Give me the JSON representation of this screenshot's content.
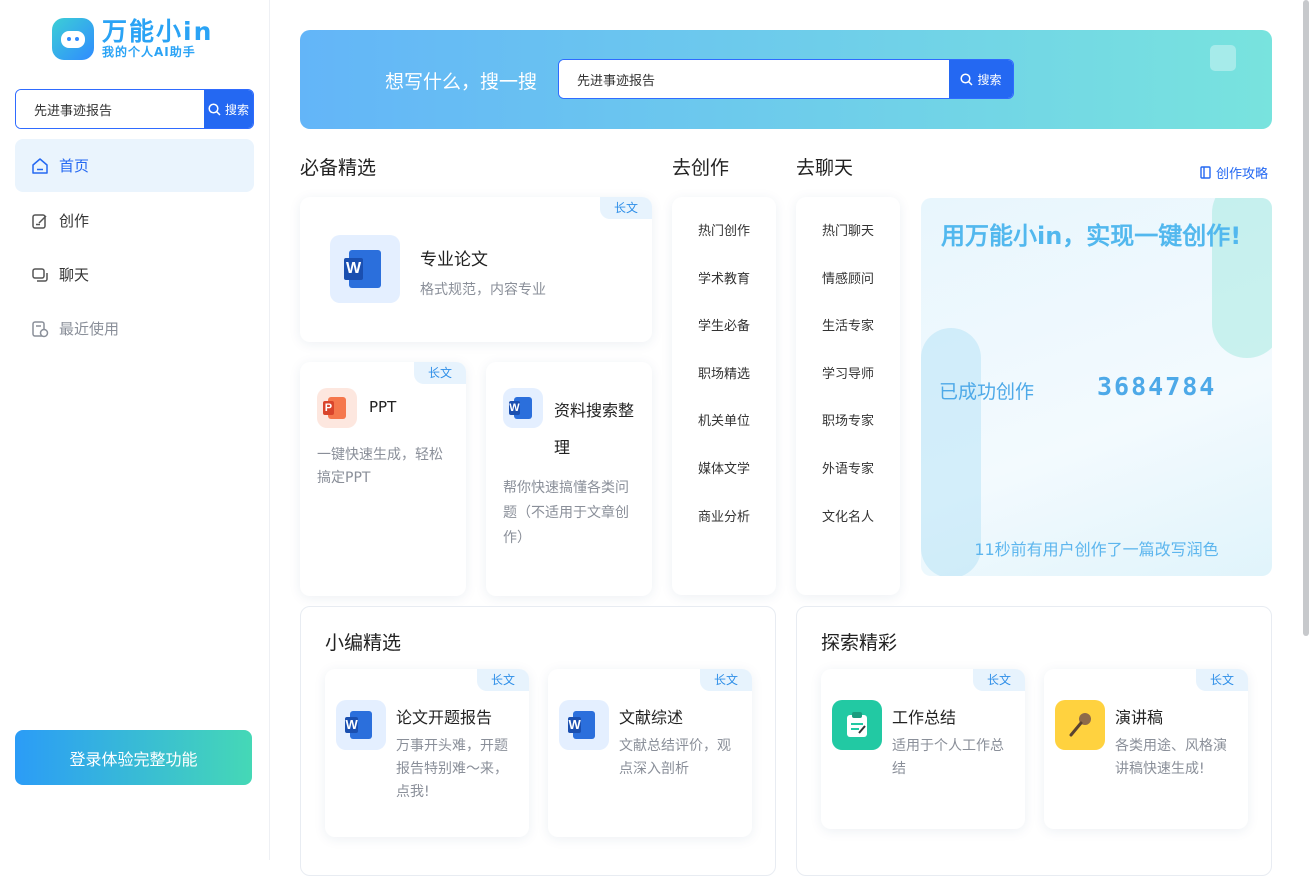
{
  "brand": {
    "title": "万能小in",
    "subtitle": "我的个人AI助手"
  },
  "sidebar": {
    "search_value": "先进事迹报告",
    "search_label": "搜索",
    "items": [
      {
        "label": "首页"
      },
      {
        "label": "创作"
      },
      {
        "label": "聊天"
      },
      {
        "label": "最近使用"
      }
    ],
    "login_label": "登录体验完整功能"
  },
  "banner": {
    "prompt": "想写什么，搜一搜",
    "search_value": "先进事迹报告",
    "search_label": "搜索"
  },
  "sections": {
    "essentials": "必备精选",
    "create": "去创作",
    "chat": "去聊天",
    "guide": "创作攻略"
  },
  "essentials": {
    "tag": "长文",
    "big": {
      "title": "专业论文",
      "desc": "格式规范，内容专业"
    },
    "ppt": {
      "title": "PPT",
      "desc": "一键快速生成，轻松搞定PPT",
      "tag": "长文"
    },
    "research": {
      "title": "资料搜索整理",
      "desc": "帮你快速搞懂各类问题（不适用于文章创作）"
    }
  },
  "create_list": [
    "热门创作",
    "学术教育",
    "学生必备",
    "职场精选",
    "机关单位",
    "媒体文学",
    "商业分析"
  ],
  "chat_list": [
    "热门聊天",
    "情感顾问",
    "生活专家",
    "学习导师",
    "职场专家",
    "外语专家",
    "文化名人"
  ],
  "promo": {
    "title": "用万能小in，实现一键创作!",
    "made_label": "已成功创作",
    "count": "3684784",
    "footer": "11秒前有用户创作了一篇改写润色"
  },
  "editors_pick": {
    "title": "小编精选",
    "cards": [
      {
        "title": "论文开题报告",
        "desc": "万事开头难，开题报告特别难～来，点我!",
        "tag": "长文"
      },
      {
        "title": "文献综述",
        "desc": "文献总结评价，观点深入剖析",
        "tag": "长文"
      }
    ]
  },
  "explore": {
    "title": "探索精彩",
    "cards": [
      {
        "title": "工作总结",
        "desc": "适用于个人工作总结",
        "tag": "长文"
      },
      {
        "title": "演讲稿",
        "desc": "各类用途、风格演讲稿快速生成!",
        "tag": "长文"
      }
    ]
  },
  "colors": {
    "accent": "#2468f2",
    "teal": "#22c9a3",
    "yellow": "#ffd23f"
  }
}
